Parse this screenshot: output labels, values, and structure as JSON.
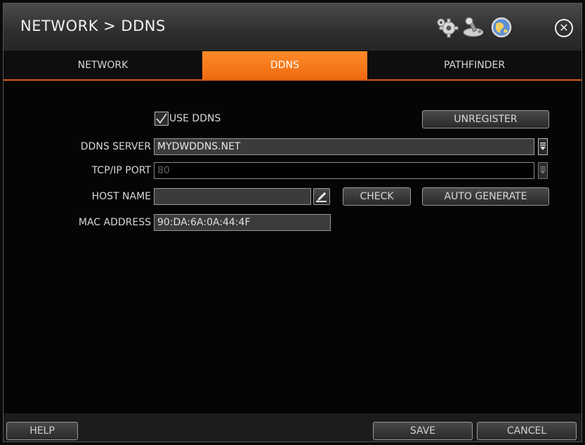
{
  "window": {
    "title": "NETWORK > DDNS"
  },
  "toolbar": {
    "icons": [
      "gear-icon",
      "joystick-icon",
      "globe-icon",
      "close-icon"
    ],
    "close_glyph": "✕"
  },
  "tabs": [
    {
      "label": "NETWORK",
      "active": false
    },
    {
      "label": "DDNS",
      "active": true
    },
    {
      "label": "PATHFINDER",
      "active": false
    }
  ],
  "form": {
    "use_ddns": {
      "label": "USE DDNS",
      "checked": true
    },
    "unregister_label": "UNREGISTER",
    "ddns_server": {
      "label": "DDNS SERVER",
      "value": "MYDWDDNS.NET"
    },
    "tcp_port": {
      "label": "TCP/IP PORT",
      "value": "80"
    },
    "host_name": {
      "label": "HOST NAME",
      "value": ""
    },
    "check_label": "CHECK",
    "auto_generate_label": "AUTO GENERATE",
    "mac_address": {
      "label": "MAC ADDRESS",
      "value": "90:DA:6A:0A:44:4F"
    }
  },
  "footer": {
    "help_label": "HELP",
    "save_label": "SAVE",
    "cancel_label": "CANCEL"
  },
  "colors": {
    "accent": "#f07a1a",
    "tab_underline": "#d65c10"
  }
}
